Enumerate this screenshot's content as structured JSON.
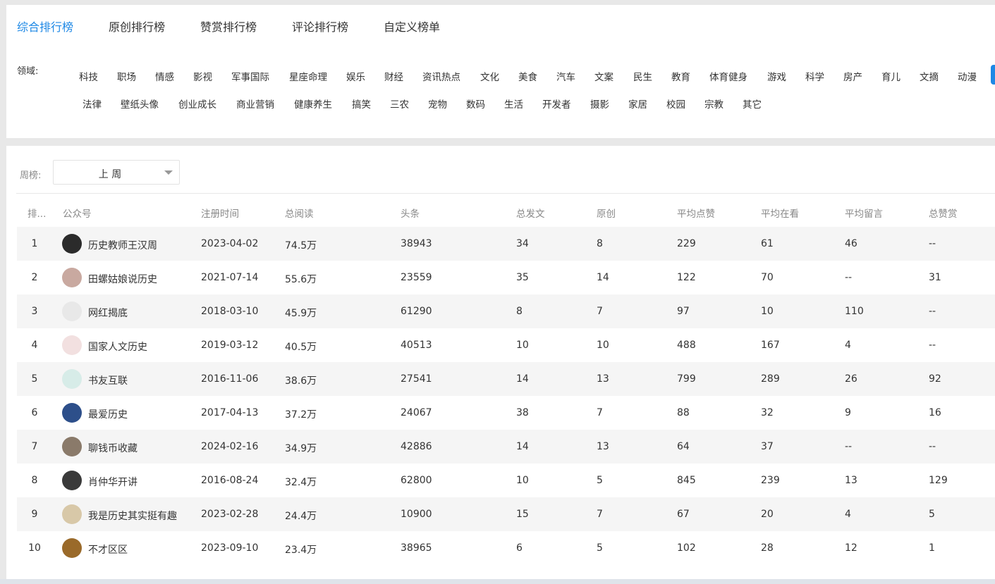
{
  "tabs": [
    "综合排行榜",
    "原创排行榜",
    "赞赏排行榜",
    "评论排行榜",
    "自定义榜单"
  ],
  "domain_label": "领域:",
  "categories_row1": [
    "科技",
    "职场",
    "情感",
    "影视",
    "军事国际",
    "星座命理",
    "娱乐",
    "财经",
    "资讯热点",
    "文化",
    "美食",
    "汽车",
    "文案",
    "民生",
    "教育",
    "体育健身",
    "游戏",
    "科学",
    "房产",
    "育儿",
    "文摘",
    "动漫"
  ],
  "categories_row2": [
    "法律",
    "壁纸头像",
    "创业成长",
    "商业营销",
    "健康养生",
    "搞笑",
    "三农",
    "宠物",
    "数码",
    "生活",
    "开发者",
    "摄影",
    "家居",
    "校园",
    "宗教",
    "其它"
  ],
  "week_label": "周榜:",
  "week_value": "上 周",
  "columns": [
    "排...",
    "公众号",
    "注册时间",
    "总阅读",
    "头条",
    "总发文",
    "原创",
    "平均点赞",
    "平均在看",
    "平均留言",
    "总赞赏"
  ],
  "rows": [
    {
      "rank": "1",
      "name": "历史教师王汉周",
      "date": "2023-04-02",
      "reads": "74.5万",
      "top": "38943",
      "posts": "34",
      "original": "8",
      "likes": "229",
      "views": "61",
      "comments": "46",
      "tips": "--"
    },
    {
      "rank": "2",
      "name": "田螺姑娘说历史",
      "date": "2021-07-14",
      "reads": "55.6万",
      "top": "23559",
      "posts": "35",
      "original": "14",
      "likes": "122",
      "views": "70",
      "comments": "--",
      "tips": "31"
    },
    {
      "rank": "3",
      "name": "网红揭底",
      "date": "2018-03-10",
      "reads": "45.9万",
      "top": "61290",
      "posts": "8",
      "original": "7",
      "likes": "97",
      "views": "10",
      "comments": "110",
      "tips": "--"
    },
    {
      "rank": "4",
      "name": "国家人文历史",
      "date": "2019-03-12",
      "reads": "40.5万",
      "top": "40513",
      "posts": "10",
      "original": "10",
      "likes": "488",
      "views": "167",
      "comments": "4",
      "tips": "--"
    },
    {
      "rank": "5",
      "name": "书友互联",
      "date": "2016-11-06",
      "reads": "38.6万",
      "top": "27541",
      "posts": "14",
      "original": "13",
      "likes": "799",
      "views": "289",
      "comments": "26",
      "tips": "92"
    },
    {
      "rank": "6",
      "name": "最爱历史",
      "date": "2017-04-13",
      "reads": "37.2万",
      "top": "24067",
      "posts": "38",
      "original": "7",
      "likes": "88",
      "views": "32",
      "comments": "9",
      "tips": "16"
    },
    {
      "rank": "7",
      "name": "聊钱币收藏",
      "date": "2024-02-16",
      "reads": "34.9万",
      "top": "42886",
      "posts": "14",
      "original": "13",
      "likes": "64",
      "views": "37",
      "comments": "--",
      "tips": "--"
    },
    {
      "rank": "8",
      "name": "肖仲华开讲",
      "date": "2016-08-24",
      "reads": "32.4万",
      "top": "62800",
      "posts": "10",
      "original": "5",
      "likes": "845",
      "views": "239",
      "comments": "13",
      "tips": "129"
    },
    {
      "rank": "9",
      "name": "我是历史其实挺有趣",
      "date": "2023-02-28",
      "reads": "24.4万",
      "top": "10900",
      "posts": "15",
      "original": "7",
      "likes": "67",
      "views": "20",
      "comments": "4",
      "tips": "5"
    },
    {
      "rank": "10",
      "name": "不才区区",
      "date": "2023-09-10",
      "reads": "23.4万",
      "top": "38965",
      "posts": "6",
      "original": "5",
      "likes": "102",
      "views": "28",
      "comments": "12",
      "tips": "1"
    }
  ],
  "colors": {
    "accent": "#1e88e5",
    "row_alt": "#f5f5f5"
  }
}
